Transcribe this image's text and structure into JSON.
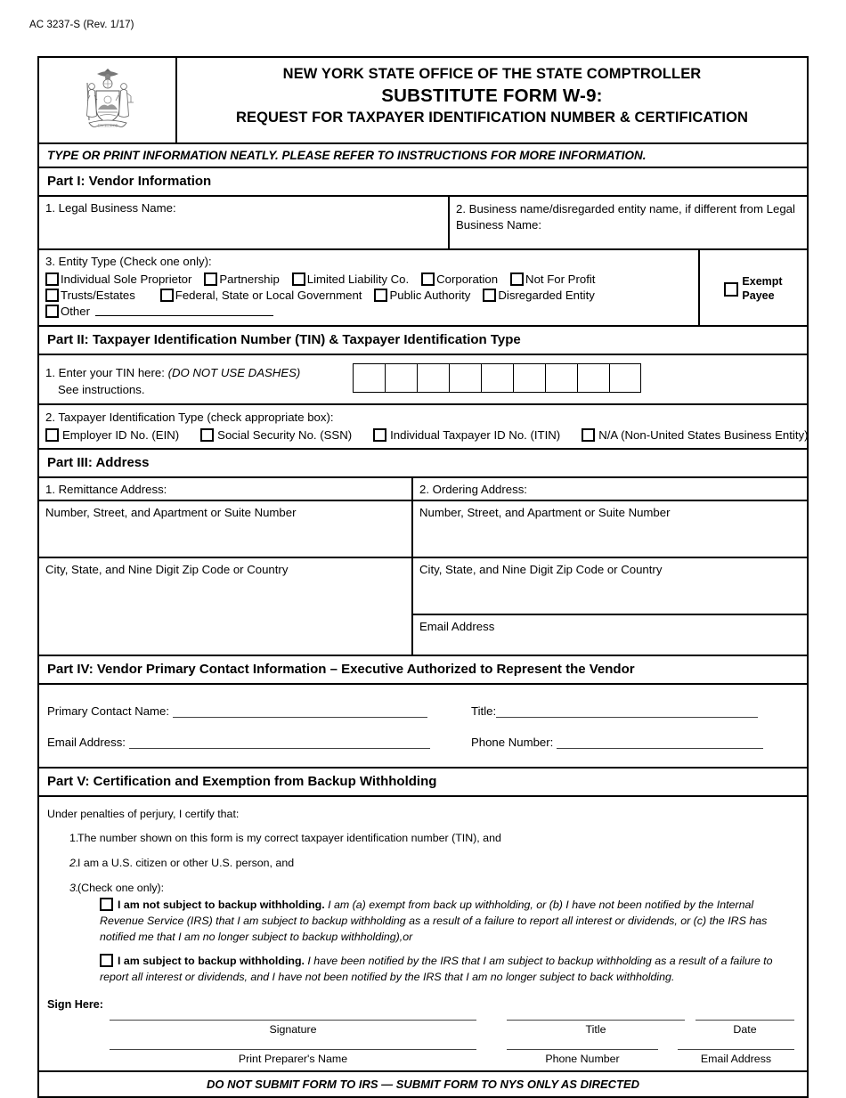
{
  "form_code": "AC 3237-S (Rev. 1/17)",
  "header": {
    "seal_alt": "new-york-state-seal",
    "line1": "NEW YORK STATE OFFICE OF THE STATE COMPTROLLER",
    "line2": "SUBSTITUTE FORM W-9:",
    "line3": "REQUEST FOR TAXPAYER IDENTIFICATION NUMBER & CERTIFICATION"
  },
  "banner": "TYPE OR PRINT INFORMATION NEATLY.  PLEASE REFER TO INSTRUCTIONS FOR MORE INFORMATION.",
  "part1": {
    "heading": "Part I: Vendor Information",
    "field1_label": "1. Legal Business Name:",
    "field2_label": "2. Business name/disregarded entity name, if different from Legal Business Name:",
    "entity_label": "3. Entity Type (Check one only):",
    "entity_row1": [
      "Individual Sole Proprietor",
      "Partnership",
      "Limited Liability Co.",
      "Corporation",
      "Not For Profit"
    ],
    "entity_row2": [
      "Trusts/Estates",
      "Federal, State or Local Government",
      "Public Authority",
      "Disregarded Entity"
    ],
    "entity_other": "Other",
    "exempt_line1": "Exempt",
    "exempt_line2": "Payee"
  },
  "part2": {
    "heading": "Part II: Taxpayer Identification Number (TIN) & Taxpayer Identification Type",
    "tin_label_1": "1. Enter your TIN here:",
    "tin_label_italic": "(DO NOT USE DASHES)",
    "tin_label_2": "See instructions.",
    "tin_box_count": 9,
    "type_label": "2. Taxpayer Identification Type (check appropriate box):",
    "type_options": [
      "Employer ID No. (EIN)",
      "Social Security No. (SSN)",
      "Individual Taxpayer ID No. (ITIN)",
      "N/A (Non-United States Business Entity)"
    ]
  },
  "part3": {
    "heading": "Part III: Address",
    "col1_label": "1.  Remittance Address:",
    "col2_label": "2. Ordering Address:",
    "street_label": "Number, Street, and Apartment or Suite Number",
    "city_label": "City, State, and Nine Digit Zip Code or Country",
    "email_label": "Email Address"
  },
  "part4": {
    "heading": "Part IV: Vendor Primary Contact Information – Executive Authorized to Represent the Vendor",
    "contact_name_label": "Primary Contact Name:",
    "title_label": "Title:",
    "email_label": "Email Address:",
    "phone_label": "Phone Number:"
  },
  "part5": {
    "heading": "Part V: Certification and Exemption from Backup Withholding",
    "intro": "Under penalties of perjury, I certify that:",
    "items": [
      {
        "num": "1.",
        "text": "The number shown on this form is my correct taxpayer identification number (TIN), and"
      },
      {
        "num": "2.",
        "text": "I am a U.S. citizen or other U.S. person, and"
      },
      {
        "num": "3.",
        "text": "(Check one only):"
      }
    ],
    "not_subject_bold": "I am not subject to backup withholding.",
    "not_subject_text": " I am (a) exempt from back up withholding, or (b) I have not been notified by the Internal Revenue Service (IRS)  that I am subject to backup withholding as a result of a failure to report all interest or dividends, or (c) the IRS has notified me that I am no longer subject to backup withholding),or",
    "subject_bold": "I am subject to backup withholding.",
    "subject_text": " I have been notified by the IRS that I am subject to backup withholding as a result of a failure to report all interest or dividends, and I have not been notified by the IRS that I am no longer subject to back withholding.",
    "sign_here": "Sign Here:",
    "sig_row1": [
      "Signature",
      "Title",
      "Date"
    ],
    "sig_row2": [
      "Print Preparer's Name",
      "Phone Number",
      "Email Address"
    ]
  },
  "footer": "DO NOT SUBMIT FORM TO IRS — SUBMIT FORM TO NYS ONLY AS DIRECTED"
}
